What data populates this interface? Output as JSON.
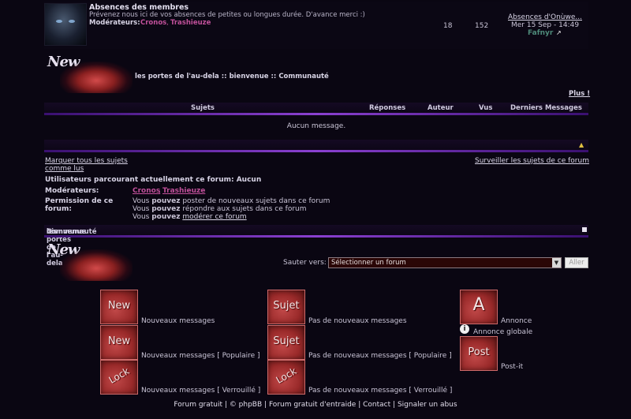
{
  "forum": {
    "title": "Absences des membres",
    "description": "Prévenez nous ici de vos absences de petites ou longues durée. D'avance merci :)",
    "moderators_label": "Modérateurs:",
    "moderator1": "Cronos",
    "moderator2": "Trashieuze",
    "topics": "18",
    "posts": "152",
    "last_title": "Absences d'Onùwe...",
    "last_date": "Mer 15 Sep - 14:49",
    "last_user": "Fafnyr"
  },
  "breadcrumb": {
    "site": "les portes de l'au-dela",
    "sep": "::",
    "cat": "bienvenue",
    "sub": "Communauté"
  },
  "logo_text": "New",
  "plus_link": "Plus !",
  "table": {
    "headers": [
      "Sujets",
      "Réponses",
      "Auteur",
      "Vus",
      "Derniers Messages"
    ],
    "empty": "Aucun message."
  },
  "actions": {
    "mark_read": "Marquer tous les sujets comme lus",
    "watch": "Surveiller les sujets de ce forum"
  },
  "info": {
    "users_label": "Utilisateurs parcourant actuellement ce forum: Aucun",
    "mods_label": "Modérateurs:",
    "perm_label": "Permission de ce forum:",
    "perm1_a": "Vous ",
    "perm1_b": "pouvez",
    "perm1_c": " poster de nouveaux sujets dans ce forum",
    "perm2_a": "Vous ",
    "perm2_b": "pouvez",
    "perm2_c": " répondre aux sujets dans ce forum",
    "perm3_a": "Vous ",
    "perm3_b": "pouvez",
    "perm3_c": "modérer ce forum"
  },
  "jump": {
    "label": "Sauter vers:",
    "selected": "Sélectionner un forum",
    "go": "Aller"
  },
  "legend": {
    "new": "Nouveaux messages",
    "nonew": "Pas de nouveaux messages",
    "new_hot": "Nouveaux messages [ Populaire ]",
    "nonew_hot": "Pas de nouveaux messages [ Populaire ]",
    "new_lock": "Nouveaux messages [ Verrouillé ]",
    "nonew_lock": "Pas de nouveaux messages [ Verrouillé ]",
    "announce": "Annonce",
    "global": "Annonce globale",
    "postit": "Post-it",
    "icon_new": "New",
    "icon_topic": "Sujet",
    "icon_lock": "Lock",
    "icon_announce": "A",
    "icon_post": "Post"
  },
  "footer": {
    "l1": "Forum gratuit",
    "l2": "© phpBB",
    "l3": "Forum gratuit d'entraide",
    "l4": "Contact",
    "l5": "Signaler un abus",
    "sep": "|"
  },
  "colors": {
    "accent": "#8a40d0",
    "moderator": "#c0509a",
    "icon_red": "#9a2a2a"
  }
}
